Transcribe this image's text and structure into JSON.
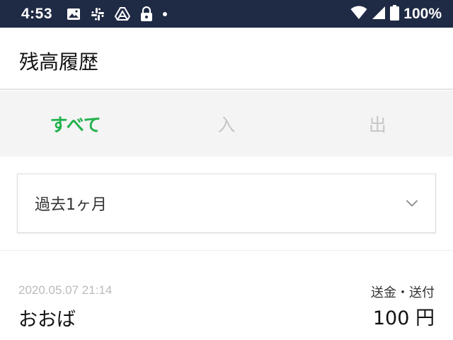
{
  "status_bar": {
    "time": "4:53",
    "battery": "100%",
    "left_icons": [
      "image-icon",
      "slack-icon",
      "drive-icon",
      "lock-icon",
      "dot-icon"
    ],
    "right_icons": [
      "wifi-icon",
      "signal-icon",
      "battery-icon"
    ]
  },
  "header": {
    "title": "残高履歴"
  },
  "tabs": [
    {
      "label": "すべて",
      "active": true
    },
    {
      "label": "入",
      "active": false
    },
    {
      "label": "出",
      "active": false
    }
  ],
  "filter": {
    "period": "過去1ヶ月"
  },
  "transactions": [
    {
      "date": "2020.05.07 21:14",
      "name": "おおば",
      "type": "送金・送付",
      "amount": "100 円"
    }
  ],
  "colors": {
    "status_bar_bg": "#1f2a44",
    "tab_active": "#22b24c",
    "tab_inactive": "#c6c6c6",
    "tabs_bg": "#f4f4f4"
  }
}
